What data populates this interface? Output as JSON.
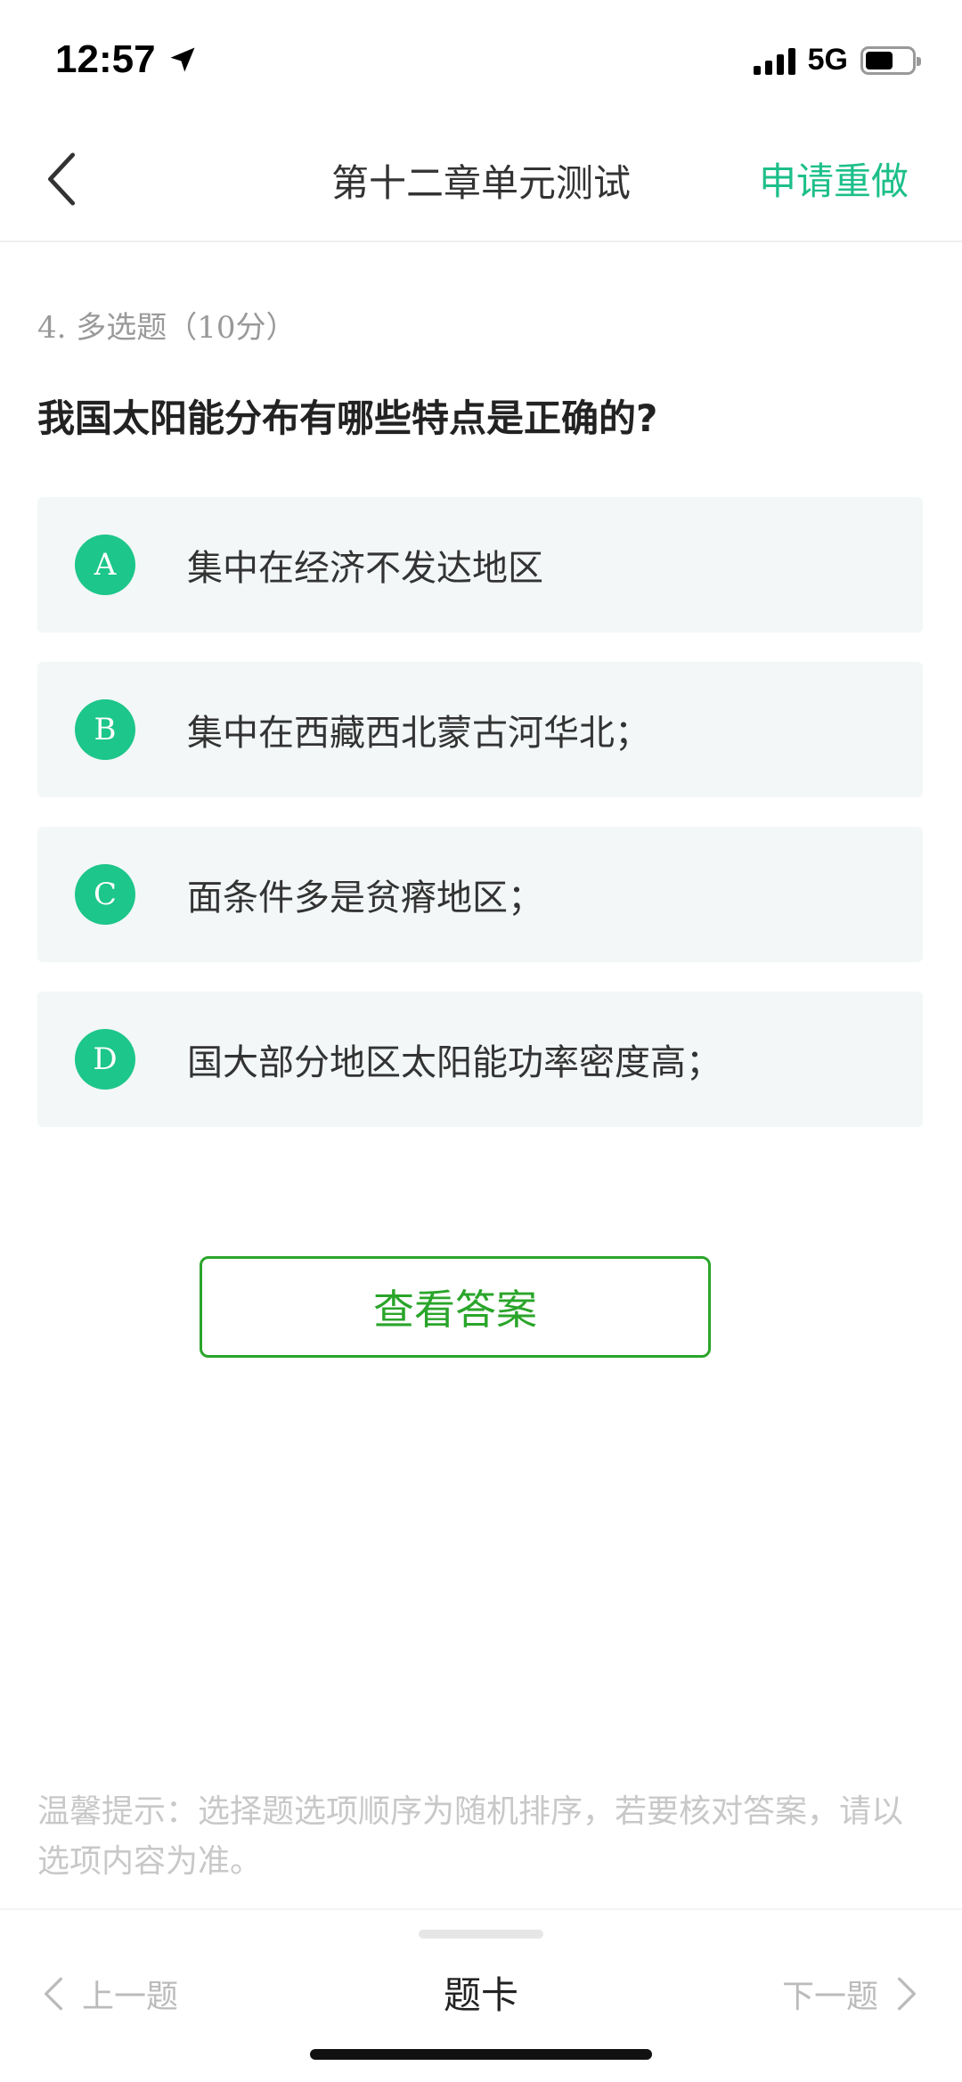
{
  "status_bar": {
    "time": "12:57",
    "network": "5G",
    "battery_level": 0.6
  },
  "nav": {
    "title": "第十二章单元测试",
    "action_label": "申请重做"
  },
  "question": {
    "meta": "4. 多选题（10分）",
    "text": "我国太阳能分布有哪些特点是正确的?",
    "options": [
      {
        "key": "A",
        "text": "集中在经济不发达地区"
      },
      {
        "key": "B",
        "text": "集中在西藏西北蒙古河华北；"
      },
      {
        "key": "C",
        "text": "面条件多是贫瘠地区；"
      },
      {
        "key": "D",
        "text": "国大部分地区太阳能功率密度高；"
      }
    ]
  },
  "answer_button_label": "查看答案",
  "tip": "温馨提示：选择题选项顺序为随机排序，若要核对答案，请以选项内容为准。",
  "bottom_nav": {
    "prev_label": "上一题",
    "card_label": "题卡",
    "next_label": "下一题"
  },
  "colors": {
    "accent": "#1dbf8a",
    "badge": "#1dc68a",
    "answer_button": "#2aa52a"
  }
}
